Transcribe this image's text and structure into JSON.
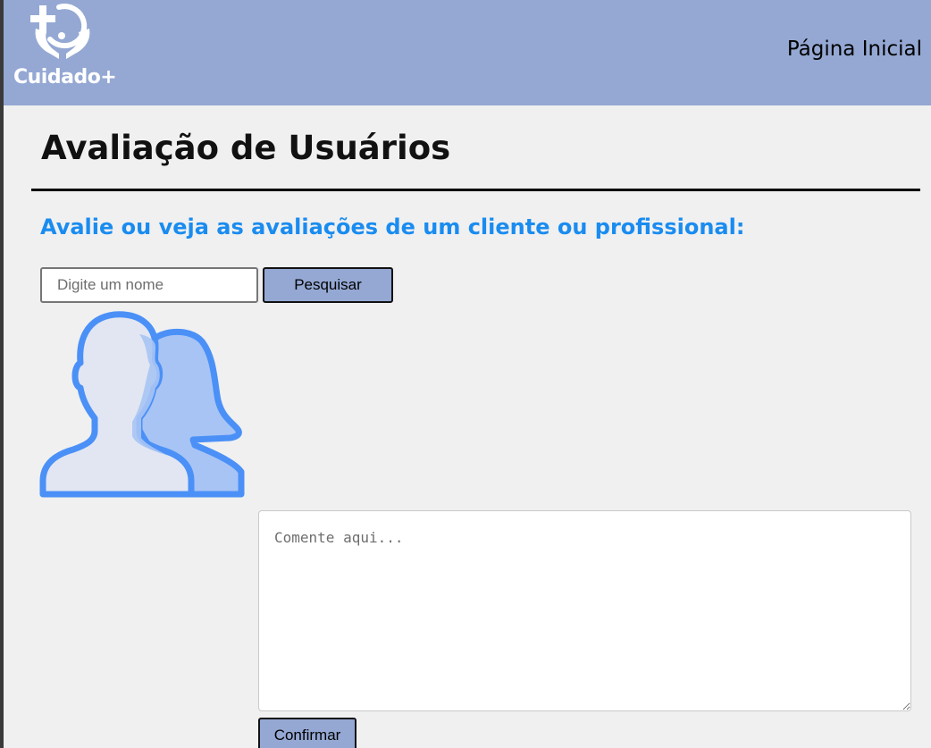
{
  "header": {
    "logo_text": "Cuidado+",
    "logo_icon": "hands-holding-plus-icon",
    "nav_home_label": "Página Inicial",
    "background_color": "#94a8d3"
  },
  "main": {
    "title": "Avaliação de Usuários",
    "subtitle": "Avalie ou veja as avaliações de um cliente ou profissional:",
    "subtitle_color": "#1a8cf0",
    "search": {
      "placeholder": "Digite um nome",
      "value": "",
      "button_label": "Pesquisar"
    },
    "avatar_icon": "users-icon",
    "comment": {
      "placeholder": "Comente aqui...",
      "value": ""
    },
    "confirm_label": "Confirmar"
  }
}
